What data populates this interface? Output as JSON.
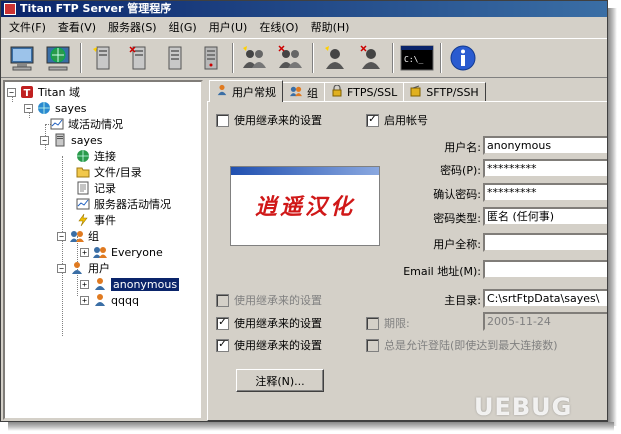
{
  "app": {
    "title": "Titan FTP Server 管理程序"
  },
  "menu": [
    {
      "label": "文件(F)"
    },
    {
      "label": "查看(V)"
    },
    {
      "label": "服务器(S)"
    },
    {
      "label": "组(G)"
    },
    {
      "label": "用户(U)"
    },
    {
      "label": "在线(O)"
    },
    {
      "label": "帮助(H)"
    }
  ],
  "toolbar": {
    "icons": [
      "computer-icon",
      "globe-icon",
      "server-add-icon",
      "server-delete-icon",
      "server-start-icon",
      "server-stop-icon",
      "group-add-icon",
      "group-delete-icon",
      "user-add-icon",
      "user-delete-icon",
      "console-icon",
      "info-icon"
    ],
    "console_text": "C:\\_"
  },
  "tree": {
    "root": "Titan 域",
    "server": "sayes",
    "server_activity": "域活动情况",
    "domain": "sayes",
    "items": [
      "连接",
      "文件/目录",
      "记录",
      "服务器活动情况",
      "事件"
    ],
    "group_label": "组",
    "group_everyone": "Everyone",
    "users_label": "用户",
    "user_anonymous": "anonymous",
    "user_qqqq": "qqqq"
  },
  "tabs": [
    {
      "label": "用户常规"
    },
    {
      "label": "组"
    },
    {
      "label": "FTPS/SSL"
    },
    {
      "label": "SFTP/SSH"
    }
  ],
  "general": {
    "inherit_label": "使用继承来的设置",
    "enable_account_label": "启用帐号",
    "logo_text": "逍遥汉化",
    "username_label": "用户名:",
    "username_value": "anonymous",
    "password_label": "密码(P):",
    "password_value": "*********",
    "confirm_label": "确认密码:",
    "confirm_value": "*********",
    "pwtype_label": "密码类型:",
    "pwtype_value": "匿名 (任何事)",
    "fullname_label": "用户全称:",
    "fullname_value": "",
    "email_label": "Email 地址(M):",
    "email_value": "",
    "homedir_label": "主目录:",
    "homedir_value": "C:\\srtFtpData\\sayes\\",
    "expire_label": "期限:",
    "expire_value": "2005-11-24",
    "always_allow_label": "总是允许登陆(即使达到最大连接数)",
    "notes_button": "注释(N)..."
  },
  "watermark": "UEBUG"
}
